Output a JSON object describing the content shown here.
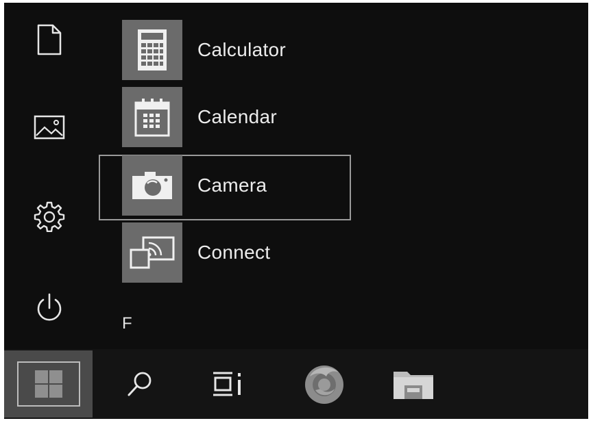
{
  "rail": {
    "items": [
      {
        "name": "documents-icon"
      },
      {
        "name": "pictures-icon"
      },
      {
        "name": "settings-gear-icon"
      },
      {
        "name": "power-icon"
      }
    ]
  },
  "apps": [
    {
      "label": "Calculator",
      "icon": "calculator-icon"
    },
    {
      "label": "Calendar",
      "icon": "calendar-icon"
    },
    {
      "label": "Camera",
      "icon": "camera-icon",
      "selected": true
    },
    {
      "label": "Connect",
      "icon": "connect-icon"
    }
  ],
  "section_header": "F",
  "taskbar": {
    "items": [
      "windows-start-icon",
      "search-icon",
      "task-view-icon",
      "firefox-icon",
      "file-explorer-icon"
    ]
  },
  "colors": {
    "background": "#0e0e0e",
    "tile": "#6b6b6b",
    "text": "#ececec",
    "taskbar": "#141414",
    "start_button": "#4a4a4a"
  }
}
